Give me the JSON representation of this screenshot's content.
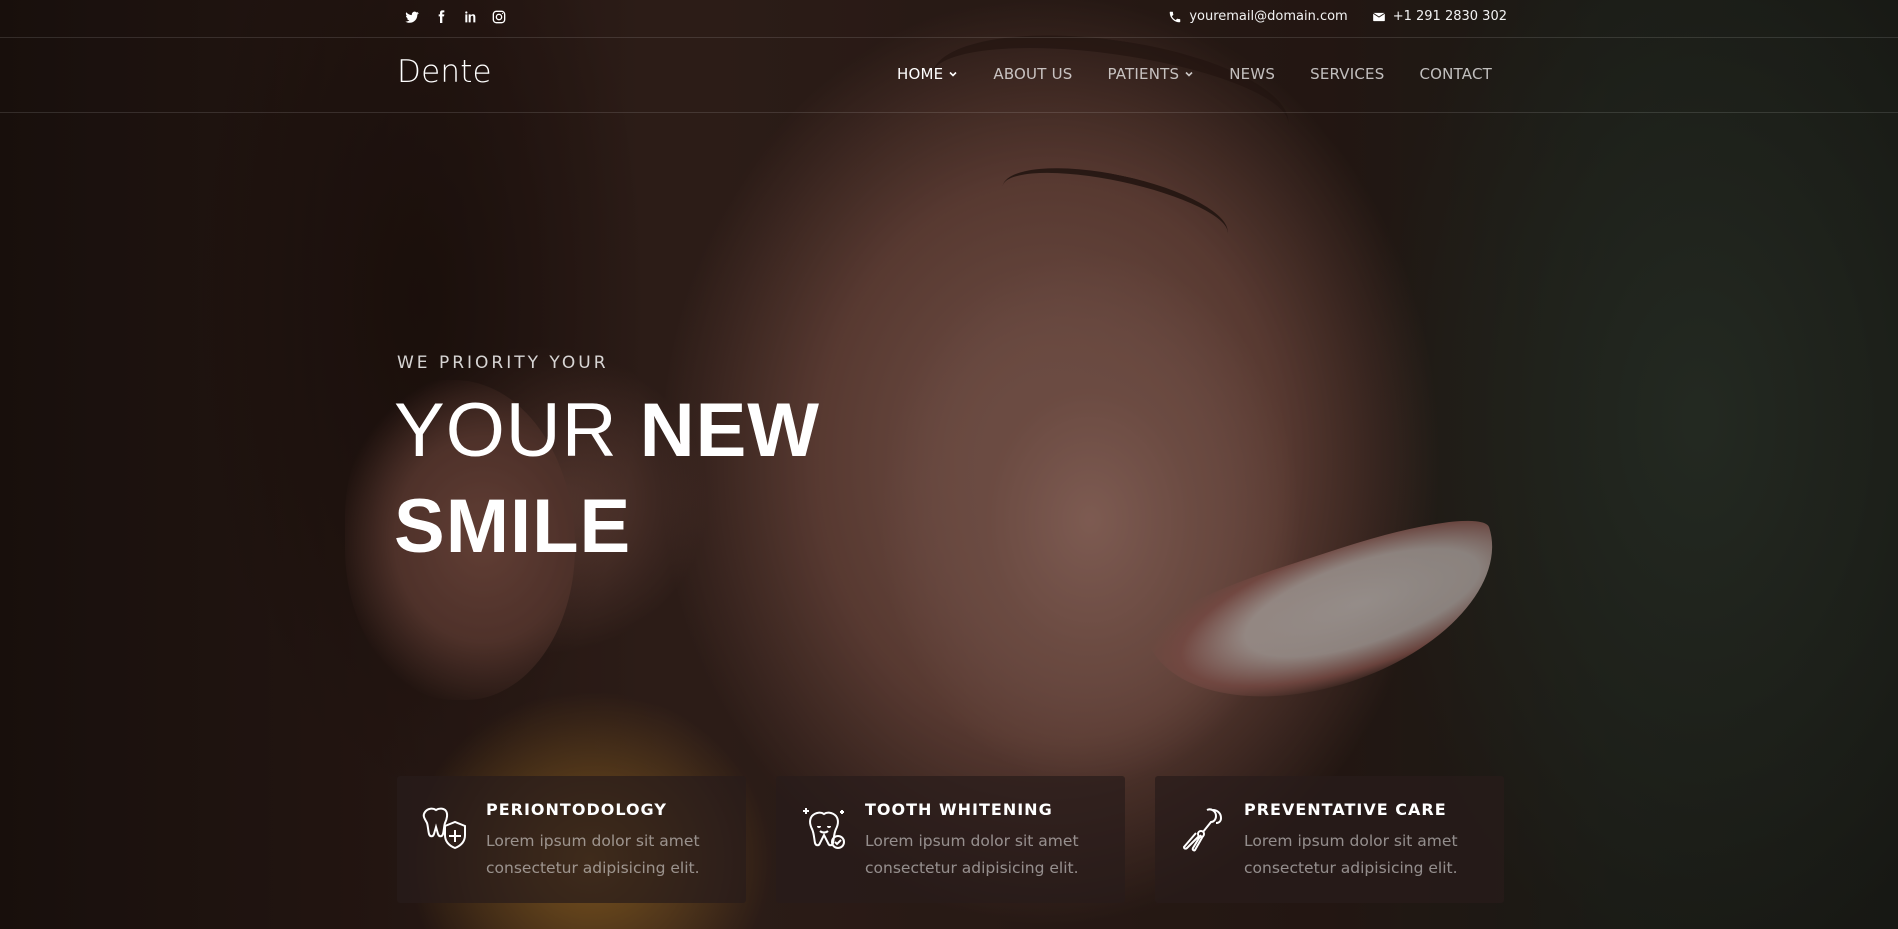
{
  "social": [
    {
      "name": "twitter-icon"
    },
    {
      "name": "facebook-icon"
    },
    {
      "name": "linkedin-icon"
    },
    {
      "name": "instagram-icon"
    }
  ],
  "contact": {
    "email": "youremail@domain.com",
    "phone": "+1 291 2830 302"
  },
  "brand": "Dente",
  "nav": {
    "items": [
      {
        "label": "HOME",
        "active": true,
        "dropdown": true
      },
      {
        "label": "ABOUT US"
      },
      {
        "label": "PATIENTS",
        "dropdown": true
      },
      {
        "label": "NEWS"
      },
      {
        "label": "SERVICES"
      },
      {
        "label": "CONTACT"
      }
    ]
  },
  "hero": {
    "subtitle": "WE PRIORITY YOUR",
    "title_light": "YOUR",
    "title_bold_1": "NEW",
    "title_bold_2": "SMILE"
  },
  "cards": [
    {
      "title": "PERIONTODOLOGY",
      "line1": "Lorem ipsum dolor sit amet",
      "line2": "consectetur adipisicing elit.",
      "icon": "tooth-shield-icon"
    },
    {
      "title": "TOOTH WHITENING",
      "line1": "Lorem ipsum dolor sit amet",
      "line2": "consectetur adipisicing elit.",
      "icon": "tooth-sparkle-icon"
    },
    {
      "title": "PREVENTATIVE CARE",
      "line1": "Lorem ipsum dolor sit amet",
      "line2": "consectetur adipisicing elit.",
      "icon": "dental-tools-icon"
    }
  ],
  "colors": {
    "text": "#ffffff",
    "muted": "#a59a98",
    "card_bg": "#281c1a"
  }
}
